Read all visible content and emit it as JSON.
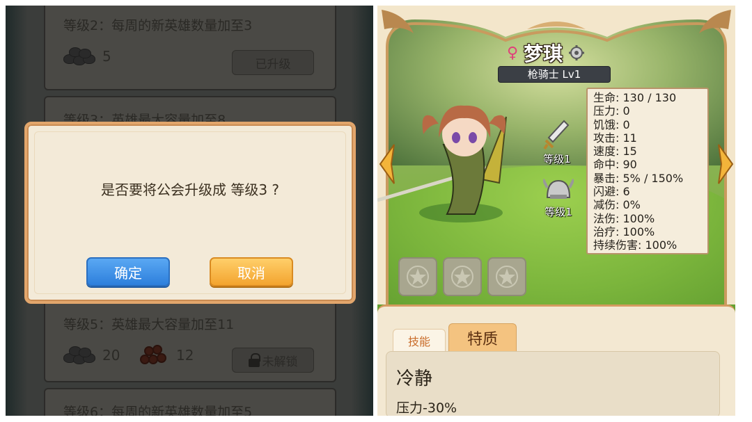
{
  "left_panel": {
    "levels": [
      {
        "title": "等级2：每周的新英雄数量加至3",
        "ore": "5",
        "button": "已升级"
      },
      {
        "title": "等级3：英雄最大容量加至8"
      },
      {
        "title": "等级5：英雄最大容量加至11",
        "ore": "20",
        "wood": "12",
        "button": "未解锁"
      },
      {
        "title": "等级6：每周的新英雄数量加至5"
      }
    ],
    "dialog": {
      "message": "是否要将公会升级成 等级3 ?",
      "confirm_label": "确定",
      "cancel_label": "取消"
    }
  },
  "right_panel": {
    "hero": {
      "gender_symbol": "♀",
      "name": "梦琪",
      "class_level": "枪骑士 Lv1"
    },
    "equipment": [
      {
        "icon": "sword-icon",
        "label": "等级1"
      },
      {
        "icon": "helmet-icon",
        "label": "等级1"
      }
    ],
    "stats": [
      "生命: 130 / 130",
      "压力: 0",
      "饥饿: 0",
      "攻击: 11",
      "速度: 15",
      "命中: 90",
      "暴击: 5% / 150%",
      "闪避: 6",
      "减伤: 0%",
      "法伤: 100%",
      "治疗: 100%",
      "持续伤害: 100%"
    ],
    "tabs": {
      "skill": "技能",
      "trait": "特质"
    },
    "trait": {
      "name": "冷静",
      "description": "压力-30%"
    }
  },
  "colors": {
    "confirm_button": "#2d7fdc",
    "cancel_button": "#f3a42f",
    "dialog_border": "#e2a66c",
    "female_symbol": "#e0407a",
    "tab_active": "#f4c380"
  }
}
